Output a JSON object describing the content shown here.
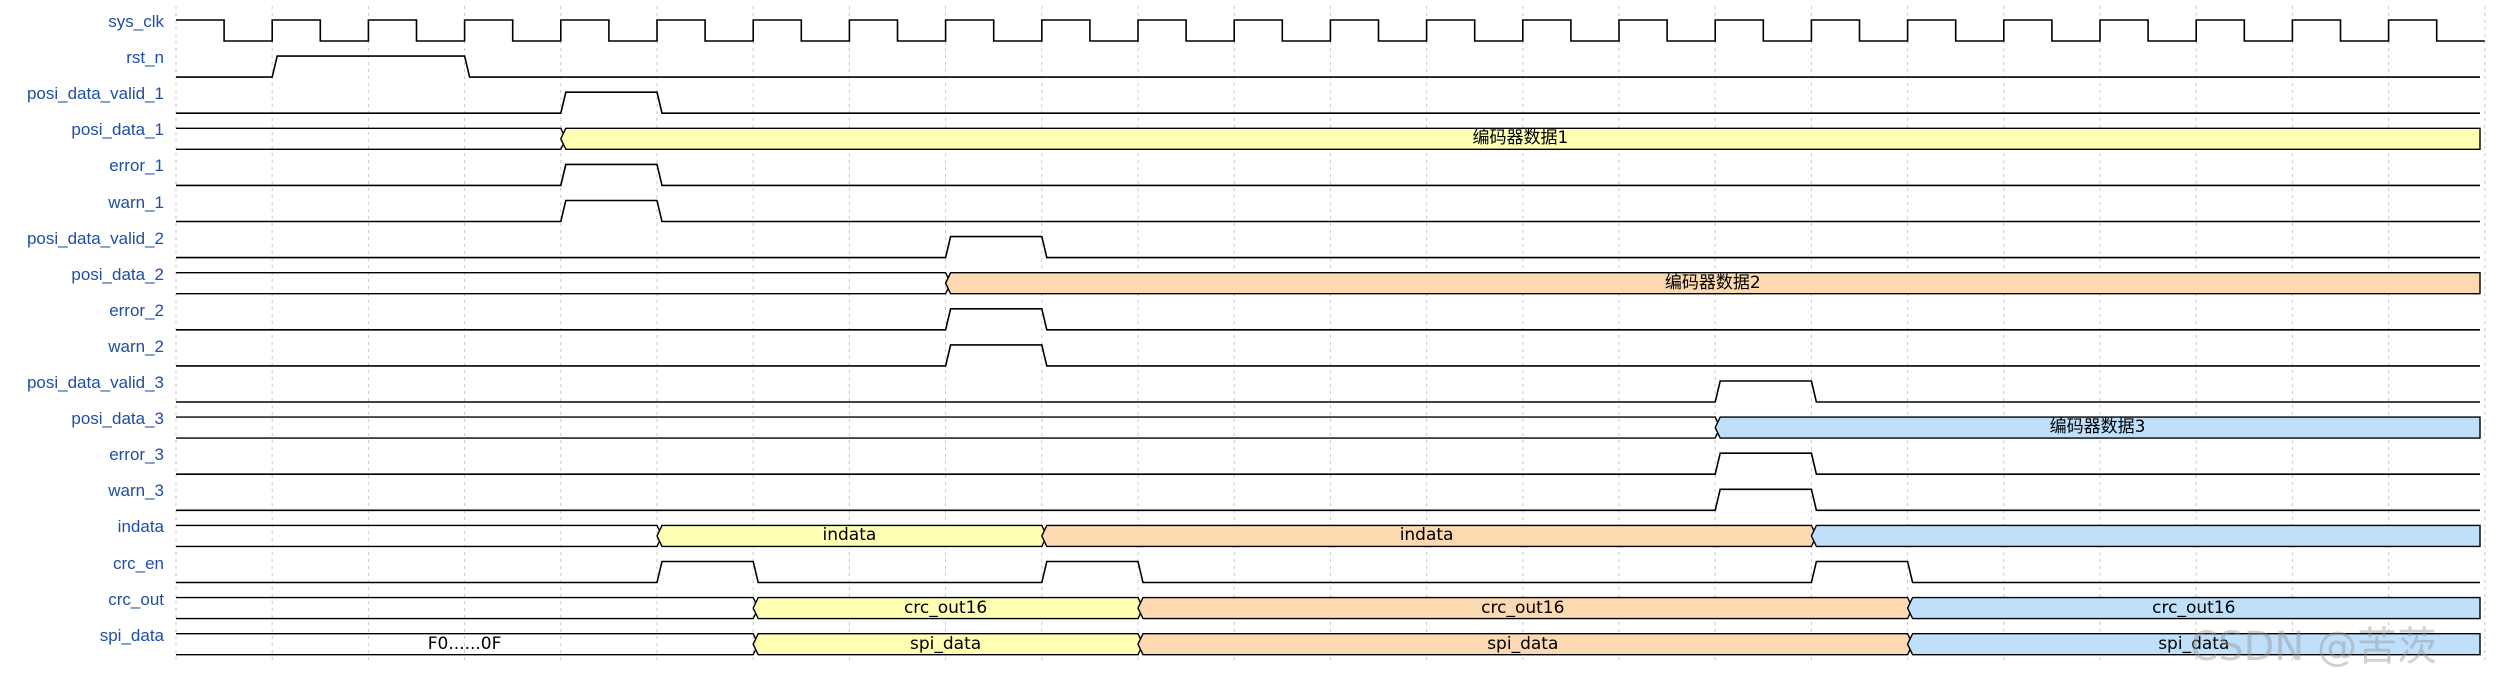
{
  "diagram": {
    "type": "timing-diagram",
    "colors": {
      "signal_name": "#1f4ea8",
      "wave_line": "#000000",
      "grid_line": "#c8c8c8",
      "yellow": "#ffffb4",
      "orange": "#fcd9b0",
      "blue": "#bfe0fb"
    },
    "signals": [
      {
        "name": "sys_clk",
        "kind": "clock"
      },
      {
        "name": "rst_n",
        "kind": "bit",
        "transitions": [
          [
            0,
            0
          ],
          [
            2,
            1
          ],
          [
            6,
            0
          ]
        ]
      },
      {
        "name": "posi_data_valid_1",
        "kind": "bit",
        "transitions": [
          [
            0,
            0
          ],
          [
            8,
            1
          ],
          [
            10,
            0
          ]
        ]
      },
      {
        "name": "posi_data_1",
        "kind": "bus",
        "segments": [
          {
            "s": 0,
            "e": 8,
            "label": "",
            "color": ""
          },
          {
            "s": 8,
            "e": 48,
            "label": "编码器数据1",
            "color": "yellow"
          }
        ]
      },
      {
        "name": "error_1",
        "kind": "bit",
        "transitions": [
          [
            0,
            0
          ],
          [
            8,
            1
          ],
          [
            10,
            0
          ]
        ]
      },
      {
        "name": "warn_1",
        "kind": "bit",
        "transitions": [
          [
            0,
            0
          ],
          [
            8,
            1
          ],
          [
            10,
            0
          ]
        ]
      },
      {
        "name": "posi_data_valid_2",
        "kind": "bit",
        "transitions": [
          [
            0,
            0
          ],
          [
            16,
            1
          ],
          [
            18,
            0
          ]
        ]
      },
      {
        "name": "posi_data_2",
        "kind": "bus",
        "segments": [
          {
            "s": 0,
            "e": 16,
            "label": "",
            "color": ""
          },
          {
            "s": 16,
            "e": 48,
            "label": "编码器数据2",
            "color": "orange"
          }
        ]
      },
      {
        "name": "error_2",
        "kind": "bit",
        "transitions": [
          [
            0,
            0
          ],
          [
            16,
            1
          ],
          [
            18,
            0
          ]
        ]
      },
      {
        "name": "warn_2",
        "kind": "bit",
        "transitions": [
          [
            0,
            0
          ],
          [
            16,
            1
          ],
          [
            18,
            0
          ]
        ]
      },
      {
        "name": "posi_data_valid_3",
        "kind": "bit",
        "transitions": [
          [
            0,
            0
          ],
          [
            32,
            1
          ],
          [
            34,
            0
          ]
        ]
      },
      {
        "name": "posi_data_3",
        "kind": "bus",
        "segments": [
          {
            "s": 0,
            "e": 32,
            "label": "",
            "color": ""
          },
          {
            "s": 32,
            "e": 48,
            "label": "编码器数据3",
            "color": "blue"
          }
        ]
      },
      {
        "name": "error_3",
        "kind": "bit",
        "transitions": [
          [
            0,
            0
          ],
          [
            32,
            1
          ],
          [
            34,
            0
          ]
        ]
      },
      {
        "name": "warn_3",
        "kind": "bit",
        "transitions": [
          [
            0,
            0
          ],
          [
            32,
            1
          ],
          [
            34,
            0
          ]
        ]
      },
      {
        "name": "indata",
        "kind": "bus",
        "segments": [
          {
            "s": 0,
            "e": 10,
            "label": "",
            "color": ""
          },
          {
            "s": 10,
            "e": 18,
            "label": "indata",
            "color": "yellow"
          },
          {
            "s": 18,
            "e": 34,
            "label": "indata",
            "color": "orange"
          },
          {
            "s": 34,
            "e": 48,
            "label": "",
            "color": "blue"
          }
        ]
      },
      {
        "name": "crc_en",
        "kind": "bit",
        "transitions": [
          [
            0,
            0
          ],
          [
            10,
            1
          ],
          [
            12,
            0
          ],
          [
            18,
            1
          ],
          [
            20,
            0
          ],
          [
            34,
            1
          ],
          [
            36,
            0
          ]
        ]
      },
      {
        "name": "crc_out",
        "kind": "bus",
        "segments": [
          {
            "s": 0,
            "e": 12,
            "label": "",
            "color": ""
          },
          {
            "s": 12,
            "e": 20,
            "label": "crc_out16",
            "color": "yellow"
          },
          {
            "s": 20,
            "e": 36,
            "label": "crc_out16",
            "color": "orange"
          },
          {
            "s": 36,
            "e": 48,
            "label": "crc_out16",
            "color": "blue"
          }
        ]
      },
      {
        "name": "spi_data",
        "kind": "bus",
        "segments": [
          {
            "s": 0,
            "e": 12,
            "label": "F0......0F",
            "color": ""
          },
          {
            "s": 12,
            "e": 20,
            "label": "spi_data",
            "color": "yellow"
          },
          {
            "s": 20,
            "e": 36,
            "label": "spi_data",
            "color": "orange"
          },
          {
            "s": 36,
            "e": 48,
            "label": "spi_data",
            "color": "blue"
          }
        ]
      }
    ]
  },
  "watermark": "CSDN @苦茨"
}
